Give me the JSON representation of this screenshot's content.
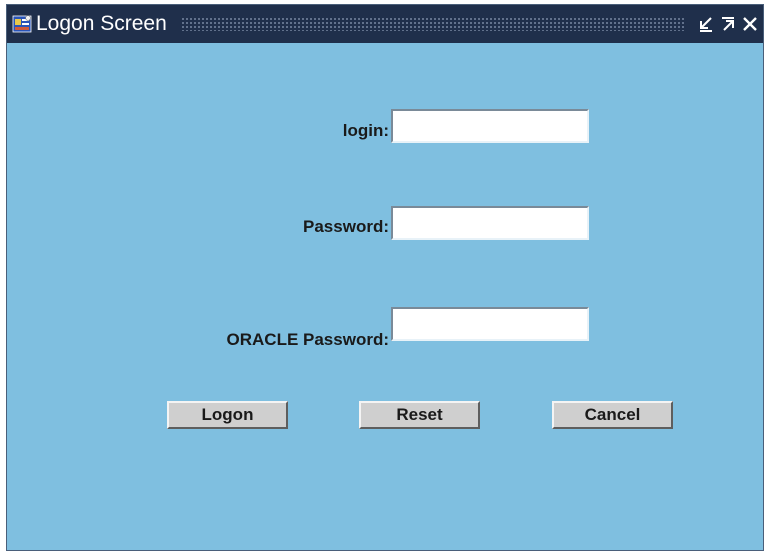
{
  "window": {
    "title": "Logon Screen",
    "minimize_glyph": "↙",
    "maximize_glyph": "↗",
    "close_glyph": "✕"
  },
  "form": {
    "login_label": "login:",
    "login_value": "",
    "password_label": "Password:",
    "password_value": "",
    "oracle_password_label": "ORACLE Password:",
    "oracle_password_value": ""
  },
  "buttons": {
    "logon_label": "Logon",
    "reset_label": "Reset",
    "cancel_label": "Cancel"
  },
  "colors": {
    "titlebar": "#1f2f4b",
    "background": "#7fbfe0",
    "button_face": "#cfcfcf"
  },
  "icons": {
    "app": "oracle-forms-app-icon",
    "minimize": "minimize-icon",
    "maximize": "maximize-icon",
    "close": "close-icon"
  }
}
